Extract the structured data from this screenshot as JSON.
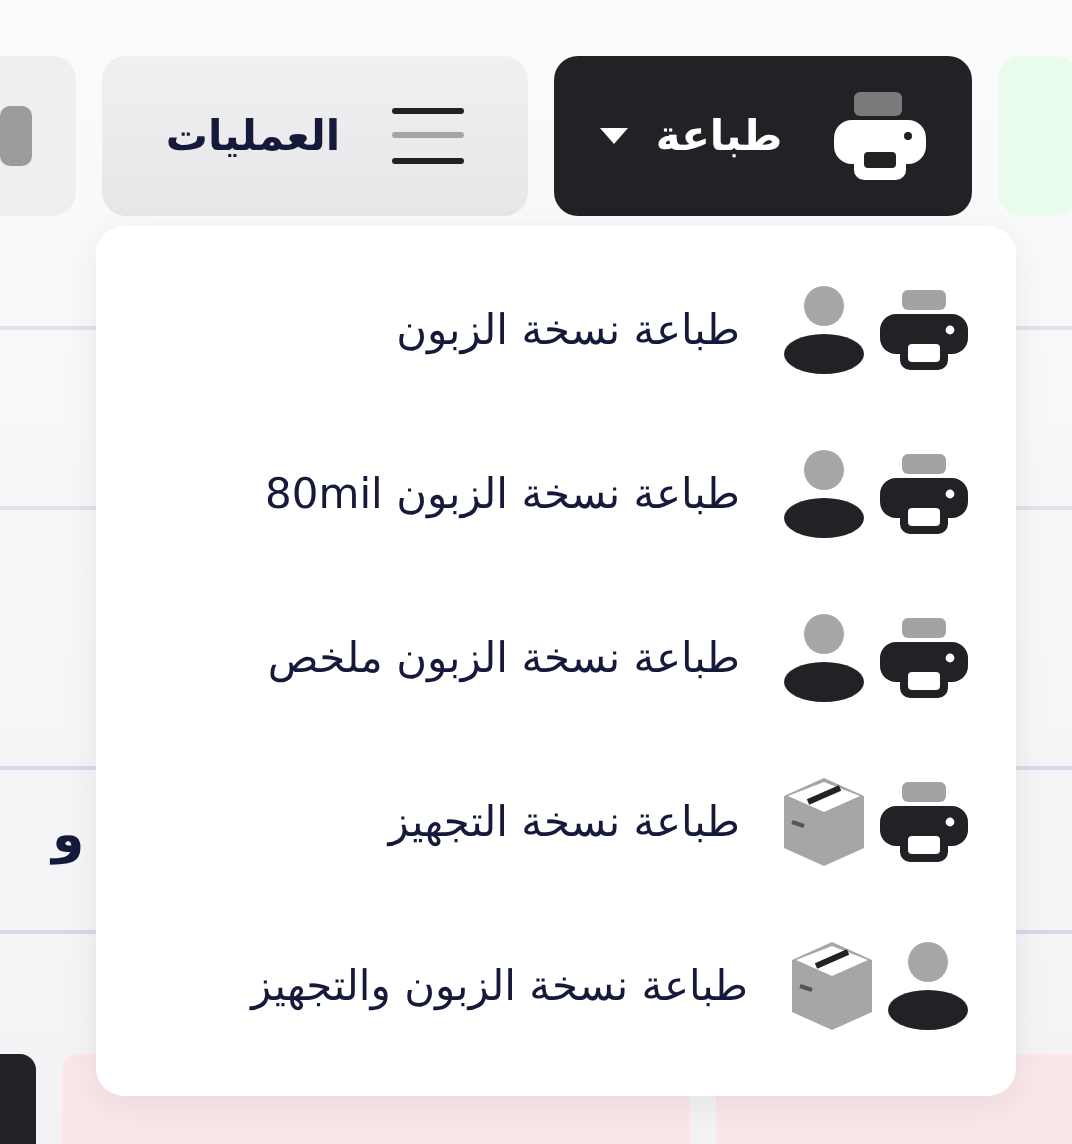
{
  "toolbar": {
    "print_button": {
      "label": "طباعة",
      "expanded": true
    },
    "operations_button": {
      "label": "العمليات"
    }
  },
  "background_row_text": "و",
  "print_menu": [
    {
      "kind": "customer",
      "label": "طباعة نسخة الزبون"
    },
    {
      "kind": "customer",
      "label": "طباعة نسخة الزبون 80mil"
    },
    {
      "kind": "customer",
      "label": "طباعة نسخة الزبون ملخص"
    },
    {
      "kind": "preparation",
      "label": "طباعة نسخة التجهيز"
    },
    {
      "kind": "customer_preparation",
      "label": "طباعة نسخة الزبون والتجهيز"
    }
  ]
}
